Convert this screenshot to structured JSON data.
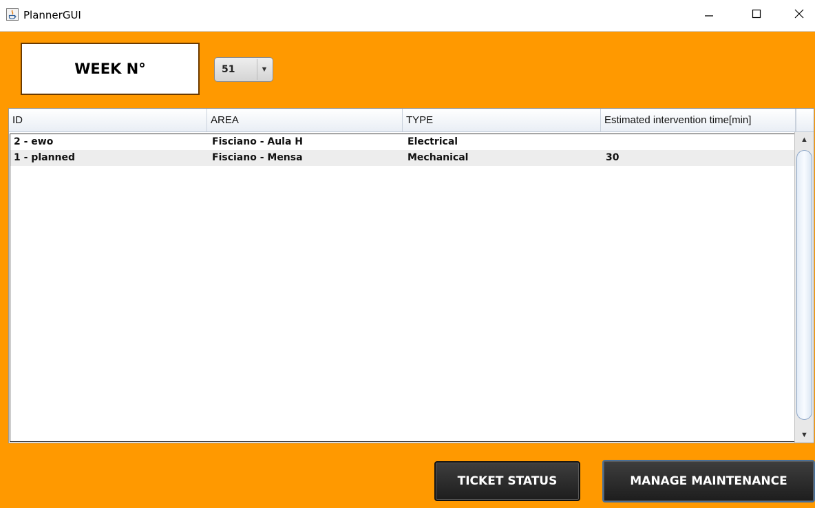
{
  "window": {
    "title": "PlannerGUI",
    "icon": "java-icon",
    "controls": [
      "minimize-icon",
      "maximize-icon",
      "close-icon"
    ]
  },
  "week": {
    "label": "WEEK N°",
    "selected": "51"
  },
  "table": {
    "columns": [
      "ID",
      "AREA",
      "TYPE",
      "Estimated intervention time[min]"
    ],
    "rows": [
      {
        "id": "2 - ewo",
        "area": "Fisciano - Aula H",
        "type": "Electrical",
        "time": ""
      },
      {
        "id": "1 - planned",
        "area": "Fisciano - Mensa",
        "type": "Mechanical",
        "time": "30"
      }
    ]
  },
  "buttons": {
    "ticket_status": "TICKET STATUS",
    "manage_maintenance": "MANAGE MAINTENANCE"
  },
  "colors": {
    "background": "#ff9900",
    "button_dark": "#2a2a2a"
  }
}
